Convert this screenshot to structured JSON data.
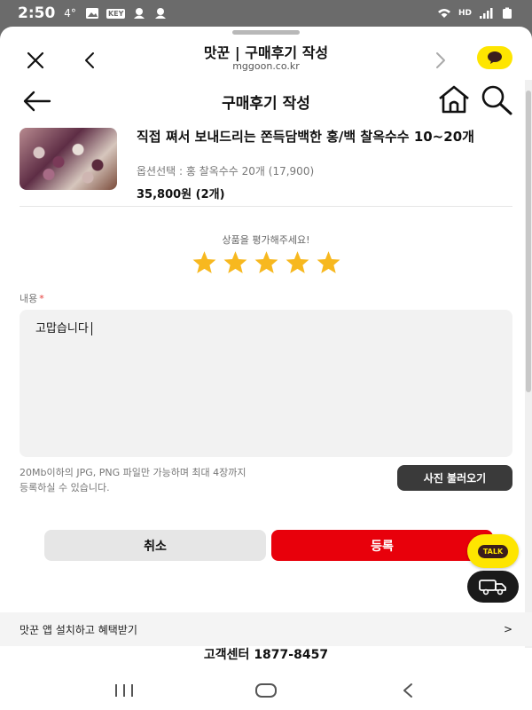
{
  "status_bar": {
    "time": "2:50",
    "temp": "4°",
    "key_badge": "KEY",
    "hd_badge": "HD"
  },
  "browser": {
    "title": "맛꾼 | 구매후기 작성",
    "url": "mggoon.co.kr",
    "kakao_color": "#fee500"
  },
  "page": {
    "title": "구매후기 작성"
  },
  "product": {
    "name": "직접 쪄서 보내드리는 쫀득담백한 홍/백 찰옥수수 10~20개",
    "option": "옵션선택 : 홍 찰옥수수 20개 (17,900)",
    "price": "35,800원 (2개)"
  },
  "rating": {
    "prompt": "상품을 평가해주세요!",
    "value": 5,
    "max": 5,
    "star_color": "#f7b81f"
  },
  "review": {
    "label": "내용",
    "required_mark": "*",
    "text": "고맙습니다"
  },
  "upload": {
    "note_line1": "20Mb이하의 JPG, PNG 파일만 가능하며 최대 4장까지",
    "note_line2": "등록하실 수 있습니다.",
    "button_label": "사진 불러오기"
  },
  "actions": {
    "cancel_label": "취소",
    "submit_label": "등록",
    "submit_color": "#e8000b"
  },
  "fab": {
    "talk_label": "TALK"
  },
  "footer": {
    "app_banner_label": "맛꾼 앱 설치하고 혜택받기",
    "app_banner_chevron": ">",
    "customer_center": "고객센터 1877-8457"
  }
}
